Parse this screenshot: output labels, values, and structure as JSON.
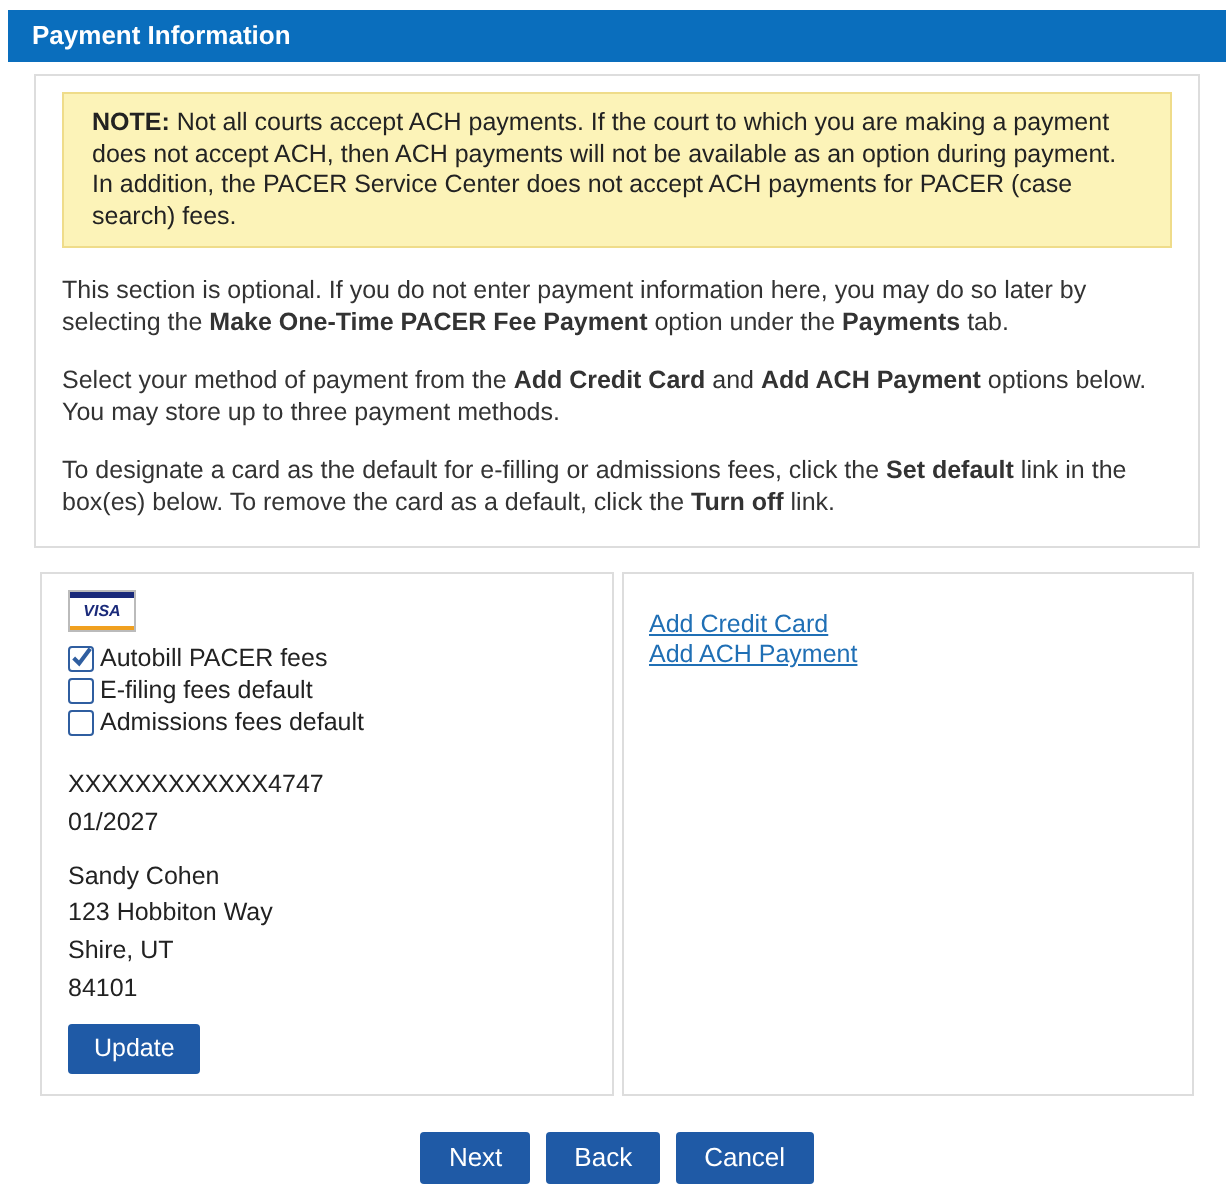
{
  "header": {
    "title": "Payment Information"
  },
  "note": "**NOTE:** Not all courts accept ACH payments. If the court to which you are making a payment does not accept ACH, then ACH payments will not be available as an option during payment. In addition, the PACER Service Center does not accept ACH payments for PACER (case search) fees.",
  "paragraphs": [
    "This section is optional. If you do not enter payment information here, you may do so later by selecting the **Make One-Time PACER Fee Payment** option under the **Payments** tab.",
    "Select your method of payment from the **Add Credit Card** and **Add ACH Payment** options below. You may store up to three payment methods.",
    "To designate a card as the default for e-filling or admissions fees, click the **Set default** link in the box(es) below. To remove the card as a default, click the **Turn off** link."
  ],
  "card": {
    "brand": "VISA",
    "options": [
      {
        "label": "Autobill PACER fees",
        "checked": true
      },
      {
        "label": "E-filing fees default",
        "checked": false
      },
      {
        "label": "Admissions fees default",
        "checked": false
      }
    ],
    "number": "XXXXXXXXXXXX4747",
    "expiry": "01/2027",
    "address": [
      "Sandy Cohen",
      "123 Hobbiton Way",
      "Shire, UT",
      "84101"
    ],
    "update_button": "Update"
  },
  "links": [
    "Add Credit Card",
    "Add ACH Payment"
  ],
  "buttons": [
    "Next",
    "Back",
    "Cancel"
  ]
}
